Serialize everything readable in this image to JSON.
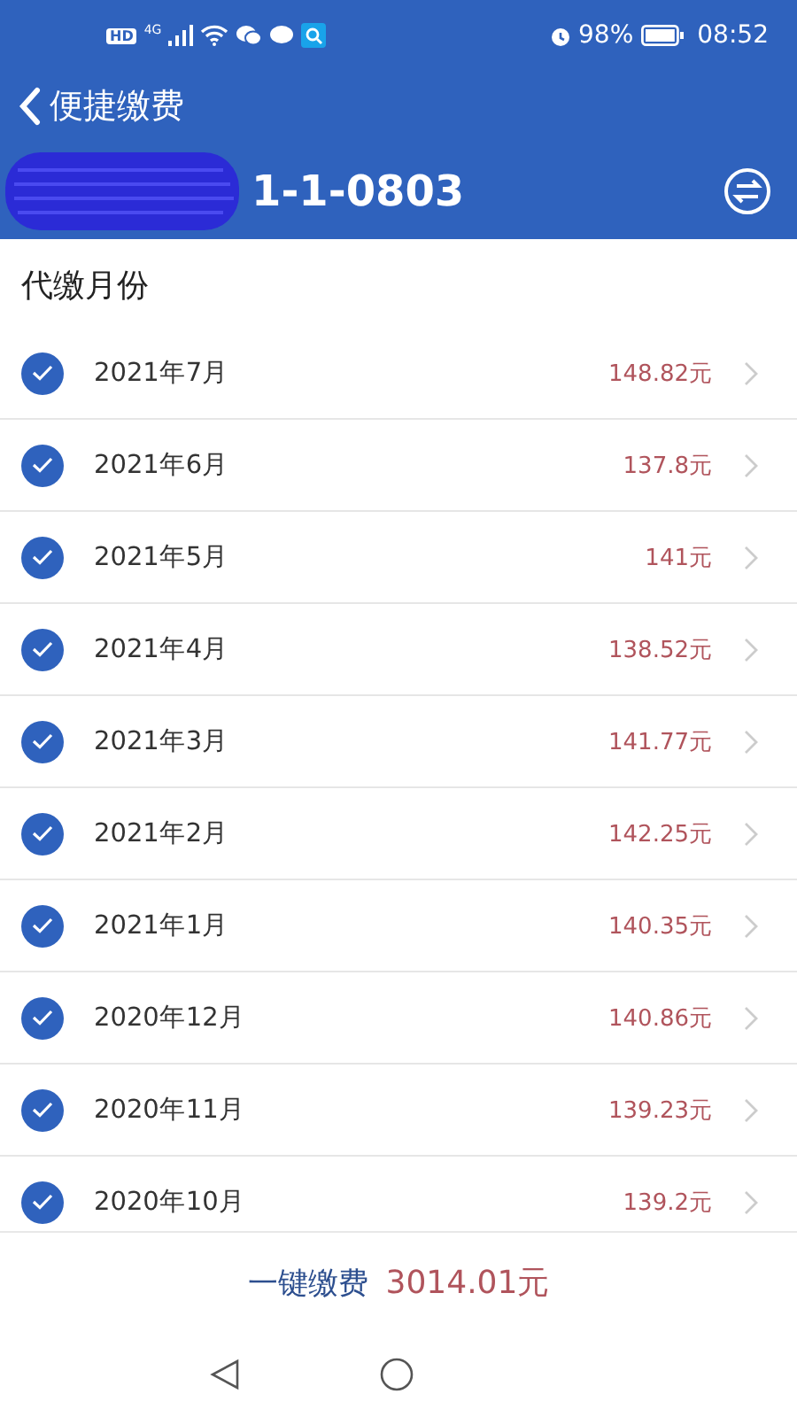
{
  "status_bar": {
    "hd": "HD",
    "network": "4G",
    "battery": "98%",
    "time": "08:52"
  },
  "header": {
    "back_title": "便捷缴费",
    "account": "1-1-0803"
  },
  "section_title": "代缴月份",
  "months": [
    {
      "month": "2021年7月",
      "amount": "148.82元",
      "checked": true
    },
    {
      "month": "2021年6月",
      "amount": "137.8元",
      "checked": true
    },
    {
      "month": "2021年5月",
      "amount": "141元",
      "checked": true
    },
    {
      "month": "2021年4月",
      "amount": "138.52元",
      "checked": true
    },
    {
      "month": "2021年3月",
      "amount": "141.77元",
      "checked": true
    },
    {
      "month": "2021年2月",
      "amount": "142.25元",
      "checked": true
    },
    {
      "month": "2021年1月",
      "amount": "140.35元",
      "checked": true
    },
    {
      "month": "2020年12月",
      "amount": "140.86元",
      "checked": true
    },
    {
      "month": "2020年11月",
      "amount": "139.23元",
      "checked": true
    },
    {
      "month": "2020年10月",
      "amount": "139.2元",
      "checked": true
    }
  ],
  "pay_bar": {
    "label": "一键缴费",
    "total": "3014.01元"
  }
}
